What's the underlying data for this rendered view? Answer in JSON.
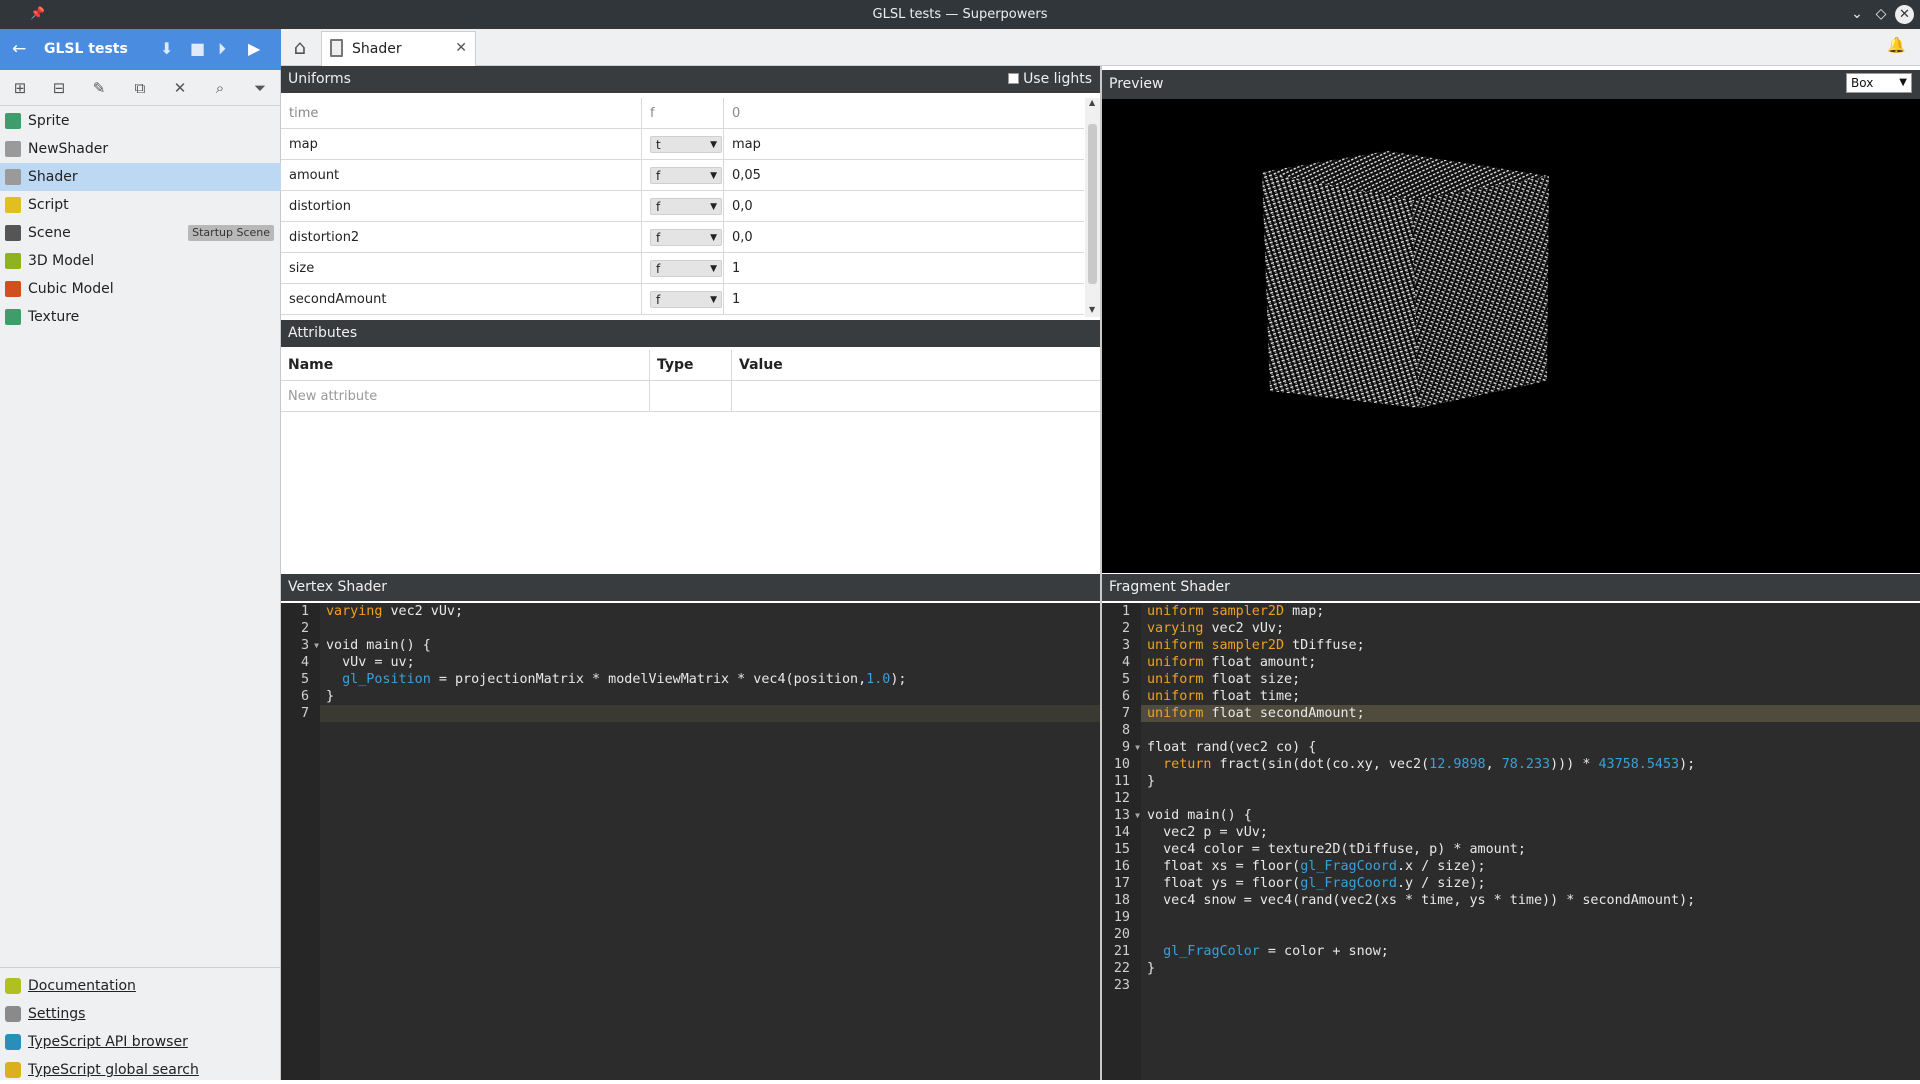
{
  "window": {
    "title": "GLSL tests — Superpowers"
  },
  "project": {
    "name": "GLSL tests"
  },
  "assets": [
    {
      "label": "Sprite",
      "color": "#3f9c6b"
    },
    {
      "label": "NewShader",
      "color": "#9a9a9a"
    },
    {
      "label": "Shader",
      "color": "#9a9a9a",
      "selected": true
    },
    {
      "label": "Script",
      "color": "#e0c020"
    },
    {
      "label": "Scene",
      "color": "#555555",
      "badge": "Startup Scene"
    },
    {
      "label": "3D Model",
      "color": "#8fb320"
    },
    {
      "label": "Cubic Model",
      "color": "#d0501f"
    },
    {
      "label": "Texture",
      "color": "#3f9c6b"
    }
  ],
  "links": [
    {
      "label": "Documentation",
      "color": "#b0c020"
    },
    {
      "label": "Settings",
      "color": "#8a8a8a"
    },
    {
      "label": "TypeScript API browser",
      "color": "#2a8fb8"
    },
    {
      "label": "TypeScript global search",
      "color": "#d8b020"
    }
  ],
  "tab": {
    "label": "Shader"
  },
  "uniforms": {
    "title": "Uniforms",
    "use_lights_label": "Use lights",
    "placeholder": {
      "name": "time",
      "type": "f",
      "value": "0"
    },
    "rows": [
      {
        "name": "map",
        "type": "t",
        "value": "map"
      },
      {
        "name": "amount",
        "type": "f",
        "value": "0,05"
      },
      {
        "name": "distortion",
        "type": "f",
        "value": "0,0"
      },
      {
        "name": "distortion2",
        "type": "f",
        "value": "0,0"
      },
      {
        "name": "size",
        "type": "f",
        "value": "1"
      },
      {
        "name": "secondAmount",
        "type": "f",
        "value": "1"
      }
    ]
  },
  "attributes": {
    "title": "Attributes",
    "columns": [
      "Name",
      "Type",
      "Value"
    ],
    "new_placeholder": "New attribute"
  },
  "preview": {
    "title": "Preview",
    "shape": "Box"
  },
  "vertex_shader": {
    "title": "Vertex Shader",
    "lines": [
      [
        [
          "k",
          "varying"
        ],
        [
          "t",
          " vec2 vUv;"
        ]
      ],
      [],
      [
        [
          "t",
          "void main() {"
        ]
      ],
      [
        [
          "t",
          "  vUv = uv;"
        ]
      ],
      [
        [
          "t",
          "  "
        ],
        [
          "b",
          "gl_Position"
        ],
        [
          "t",
          " = projectionMatrix * modelViewMatrix * vec4(position,"
        ],
        [
          "n",
          "1.0"
        ],
        [
          "t",
          ");"
        ]
      ],
      [
        [
          "t",
          "}"
        ]
      ],
      []
    ],
    "fold_lines": [
      3
    ],
    "cursor_line": 7
  },
  "fragment_shader": {
    "title": "Fragment Shader",
    "lines": [
      [
        [
          "k",
          "uniform"
        ],
        [
          "t",
          " "
        ],
        [
          "k",
          "sampler2D"
        ],
        [
          "t",
          " map;"
        ]
      ],
      [
        [
          "k",
          "varying"
        ],
        [
          "t",
          " vec2 vUv;"
        ]
      ],
      [
        [
          "k",
          "uniform"
        ],
        [
          "t",
          " "
        ],
        [
          "k",
          "sampler2D"
        ],
        [
          "t",
          " tDiffuse;"
        ]
      ],
      [
        [
          "k",
          "uniform"
        ],
        [
          "t",
          " float amount;"
        ]
      ],
      [
        [
          "k",
          "uniform"
        ],
        [
          "t",
          " float size;"
        ]
      ],
      [
        [
          "k",
          "uniform"
        ],
        [
          "t",
          " float time;"
        ]
      ],
      [
        [
          "k",
          "uniform"
        ],
        [
          "t",
          " float secondAmount;"
        ]
      ],
      [],
      [
        [
          "t",
          "float rand(vec2 co) {"
        ]
      ],
      [
        [
          "t",
          "  "
        ],
        [
          "k",
          "return"
        ],
        [
          "t",
          " fract(sin(dot(co.xy, vec2("
        ],
        [
          "n",
          "12.9898"
        ],
        [
          "t",
          ", "
        ],
        [
          "n",
          "78.233"
        ],
        [
          "t",
          "))) * "
        ],
        [
          "n",
          "43758.5453"
        ],
        [
          "t",
          ");"
        ]
      ],
      [
        [
          "t",
          "}"
        ]
      ],
      [],
      [
        [
          "t",
          "void main() {"
        ]
      ],
      [
        [
          "t",
          "  vec2 p = vUv;"
        ]
      ],
      [
        [
          "t",
          "  vec4 color = texture2D(tDiffuse, p) * amount;"
        ]
      ],
      [
        [
          "t",
          "  float xs = floor("
        ],
        [
          "b",
          "gl_FragCoord"
        ],
        [
          "t",
          ".x / size);"
        ]
      ],
      [
        [
          "t",
          "  float ys = floor("
        ],
        [
          "b",
          "gl_FragCoord"
        ],
        [
          "t",
          ".y / size);"
        ]
      ],
      [
        [
          "t",
          "  vec4 snow = vec4(rand(vec2(xs * time, ys * time)) * secondAmount);"
        ]
      ],
      [],
      [],
      [
        [
          "t",
          "  "
        ],
        [
          "b",
          "gl_FragColor"
        ],
        [
          "t",
          " = color + snow;"
        ]
      ],
      [
        [
          "t",
          "}"
        ]
      ],
      []
    ],
    "fold_lines": [
      9,
      13
    ],
    "highlight_line": 7
  }
}
